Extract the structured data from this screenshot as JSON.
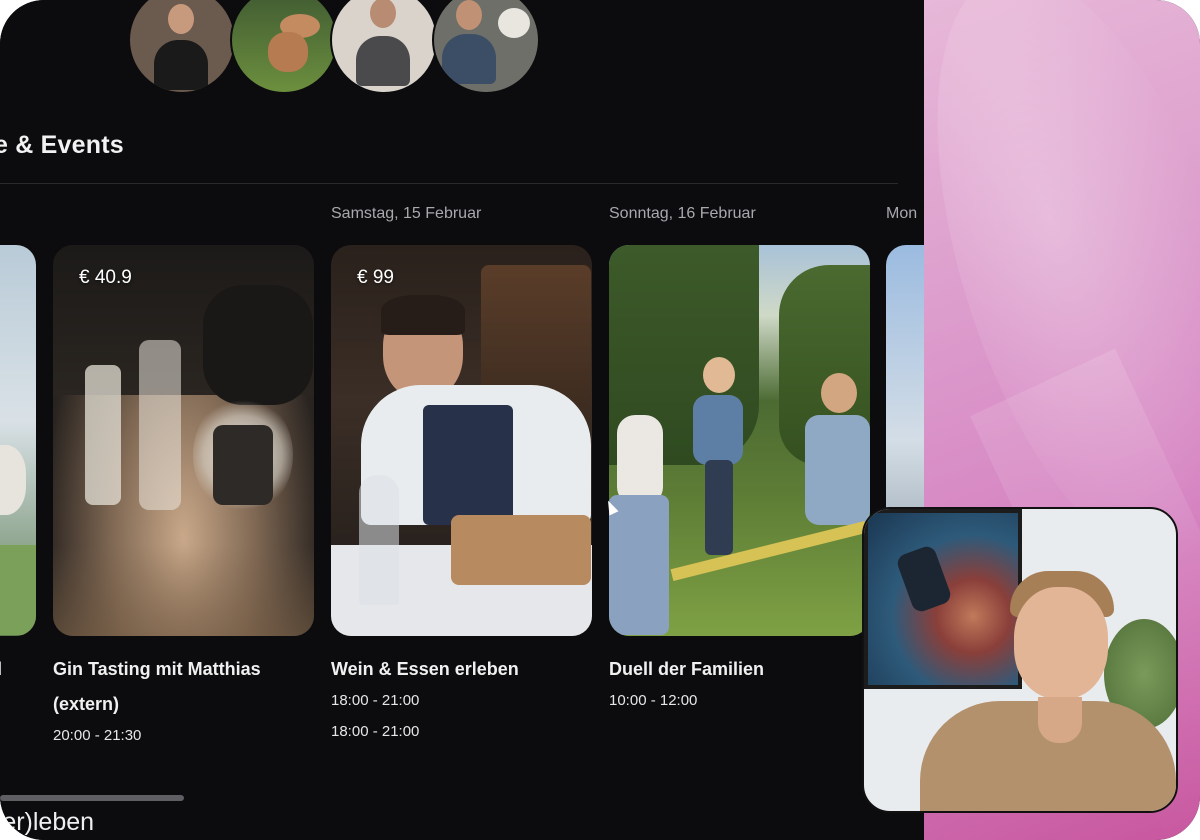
{
  "section": {
    "title": "e & Events",
    "next_title": "(er)leben"
  },
  "days": [
    {
      "label": "Samstag, 15 Februar"
    },
    {
      "label": "Sonntag, 16 Februar"
    },
    {
      "label": "Mon"
    }
  ],
  "events": [
    {
      "title": "nd",
      "times": []
    },
    {
      "price": "€ 40.9",
      "title_line1": "Gin Tasting mit Matthias",
      "title_line2": "(extern)",
      "times": [
        "20:00 - 21:30"
      ]
    },
    {
      "price": "€ 99",
      "title": "Wein & Essen erleben",
      "times": [
        "18:00 - 21:00",
        "18:00 - 21:00"
      ]
    },
    {
      "title": "Duell der Familien",
      "times": [
        "10:00 - 12:00"
      ]
    }
  ],
  "colors": {
    "background": "#0c0c0e",
    "accent_pink": "#d581c0"
  }
}
